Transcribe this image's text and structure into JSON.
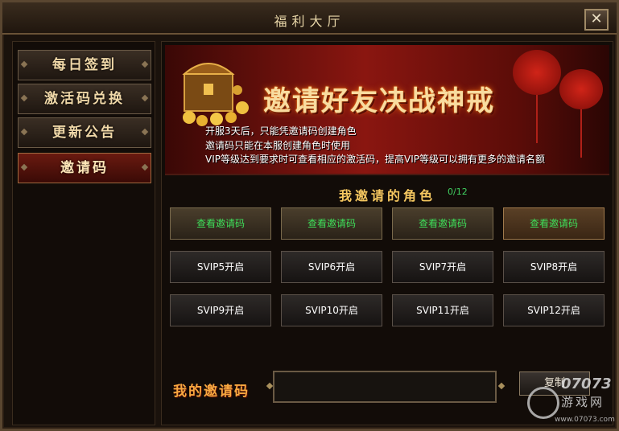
{
  "window": {
    "title": "福利大厅",
    "close_label": "✕"
  },
  "sidebar": {
    "items": [
      {
        "label": "每日签到",
        "active": false
      },
      {
        "label": "激活码兑换",
        "active": false
      },
      {
        "label": "更新公告",
        "active": false
      },
      {
        "label": "邀请码",
        "active": true
      }
    ]
  },
  "banner": {
    "headline": "邀请好友决战神戒",
    "notices": [
      "开服3天后，只能凭邀请码创建角色",
      "邀请码只能在本服创建角色时使用",
      "VIP等级达到要求时可查看相应的激活码，提高VIP等级可以拥有更多的邀请名额"
    ]
  },
  "invited": {
    "title": "我邀请的角色",
    "count": "0/12",
    "slots": [
      "查看邀请码",
      "查看邀请码",
      "查看邀请码",
      "查看邀请码",
      "SVIP5开启",
      "SVIP6开启",
      "SVIP7开启",
      "SVIP8开启",
      "SVIP9开启",
      "SVIP10开启",
      "SVIP11开启",
      "SVIP12开启"
    ]
  },
  "my_code": {
    "label": "我的邀请码",
    "value": "",
    "copy_label": "复制"
  },
  "watermark": {
    "logo": "07073",
    "text": "游戏网",
    "url": "www.07073.com"
  },
  "colors": {
    "accent_gold": "#f6c860",
    "code_green": "#3ee05a",
    "banner_red": "#8a1610",
    "active_tab": "#6a1a10"
  }
}
